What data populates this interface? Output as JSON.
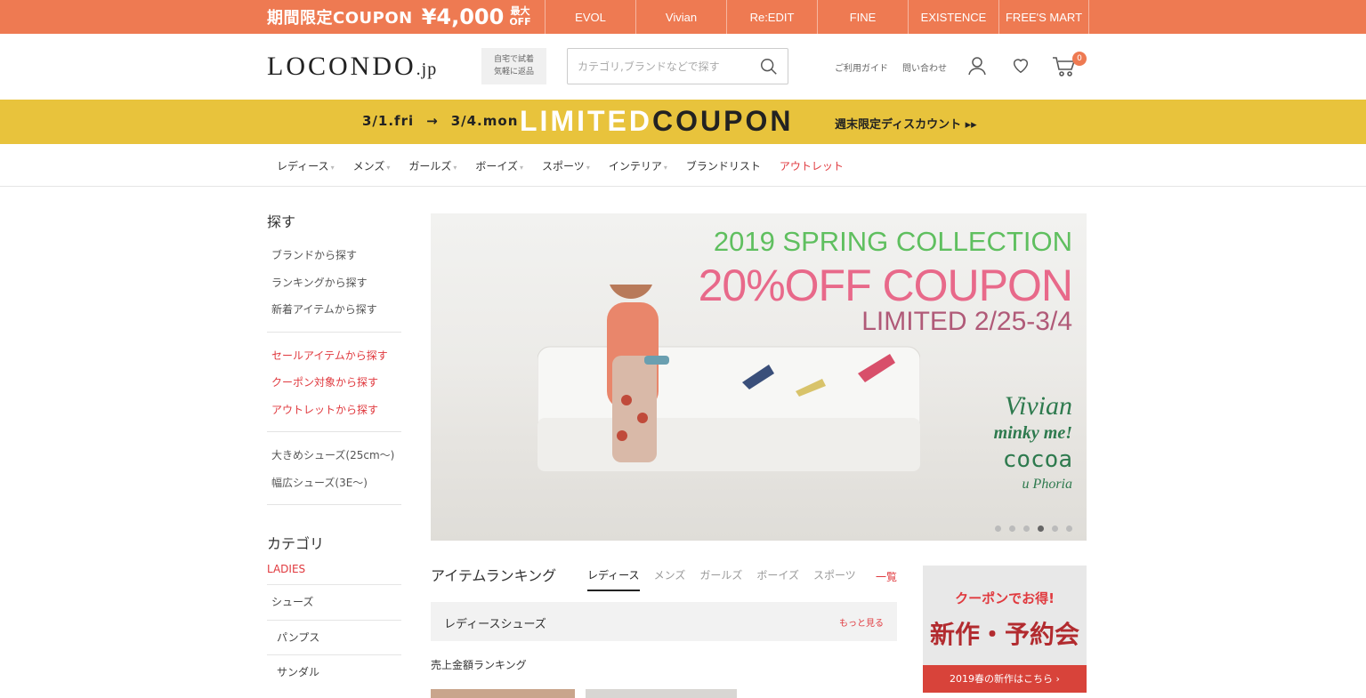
{
  "topbar": {
    "promo_text": "期間限定COUPON",
    "promo_amount": "¥4,000",
    "promo_max": "最大",
    "promo_off": "OFF",
    "brands": [
      "EVOL",
      "Vivian",
      "Re:EDIT",
      "FINE",
      "EXISTENCE",
      "FREE'S MART"
    ]
  },
  "header": {
    "logo_main": "LOCONDO",
    "logo_suffix": ".jp",
    "home_note_line1": "自宅で試着",
    "home_note_line2": "気軽に返品",
    "search_placeholder": "カテゴリ,ブランドなどで探す",
    "link_guide": "ご利用ガイド",
    "link_contact": "問い合わせ",
    "cart_count": "0",
    "icons": [
      "search-icon",
      "user-icon",
      "heart-icon",
      "cart-icon"
    ]
  },
  "coupon_bar": {
    "date_start": "3/1.fri",
    "arrow": "→",
    "date_end": "3/4.mon",
    "title_part1": "LIMITED",
    "title_part2": "COUPON",
    "weekend_text": "週末限定ディスカウント ▸▸"
  },
  "nav": {
    "items": [
      "レディース",
      "メンズ",
      "ガールズ",
      "ボーイズ",
      "スポーツ",
      "インテリア",
      "ブランドリスト",
      "アウトレット"
    ]
  },
  "sidebar": {
    "search_heading": "探す",
    "search_items": [
      "ブランドから探す",
      "ランキングから探す",
      "新着アイテムから探す"
    ],
    "sale_items": [
      "セールアイテムから探す",
      "クーポン対象から探す",
      "アウトレットから探す"
    ],
    "size_items": [
      "大きめシューズ(25cm〜)",
      "幅広シューズ(3E〜)"
    ],
    "category_heading": "カテゴリ",
    "category_group": "LADIES",
    "category_items": [
      "シューズ",
      "パンプス",
      "サンダル"
    ]
  },
  "hero": {
    "line1": "2019 SPRING COLLECTION",
    "line2": "20%OFF COUPON",
    "line3": "LIMITED 2/25-3/4",
    "brands": [
      "Vivian",
      "minky me!",
      "cocoa",
      "u Phoria"
    ],
    "slide_count": 6,
    "active_slide": 4
  },
  "ranking": {
    "heading": "アイテムランキング",
    "tabs": [
      "レディース",
      "メンズ",
      "ガールズ",
      "ボーイズ",
      "スポーツ"
    ],
    "view_all": "一覧",
    "box_label": "レディースシューズ",
    "box_more": "もっと見る",
    "sales_label": "売上金額ランキング"
  },
  "promo_card": {
    "line1": "クーポンでお得!",
    "line2": "新作・予約会",
    "button": "2019春の新作はこちら ›"
  },
  "colors": {
    "topbar": "#ee7a52",
    "coupon_bar": "#e8c33c",
    "accent_red": "#e0393e"
  }
}
